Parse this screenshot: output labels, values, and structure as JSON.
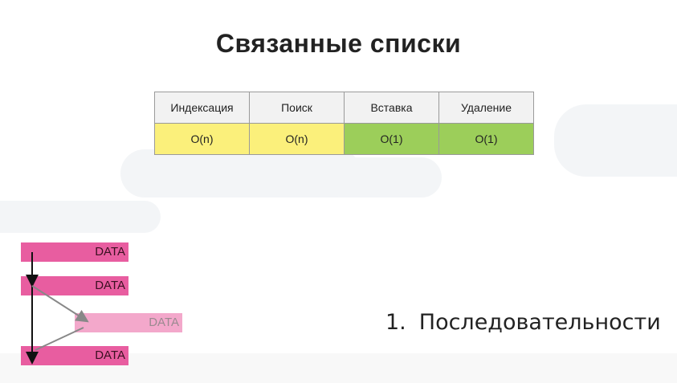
{
  "slide": {
    "title": "Связанные списки"
  },
  "complexity_table": {
    "headers": [
      "Индексация",
      "Поиск",
      "Вставка",
      "Удаление"
    ],
    "values": [
      "O(n)",
      "O(n)",
      "O(1)",
      "O(1)"
    ],
    "colors": {
      "linear": "#fbf07b",
      "constant": "#9cce5a",
      "header": "#f2f2f2"
    }
  },
  "linked_list": {
    "nodes": [
      "DATA",
      "DATA",
      "DATA",
      "DATA"
    ],
    "node_color": "#e85da0",
    "inserted_node_color": "#f3a8cb"
  },
  "bullets": [
    {
      "number": "1.",
      "text": "Последовательности"
    }
  ]
}
